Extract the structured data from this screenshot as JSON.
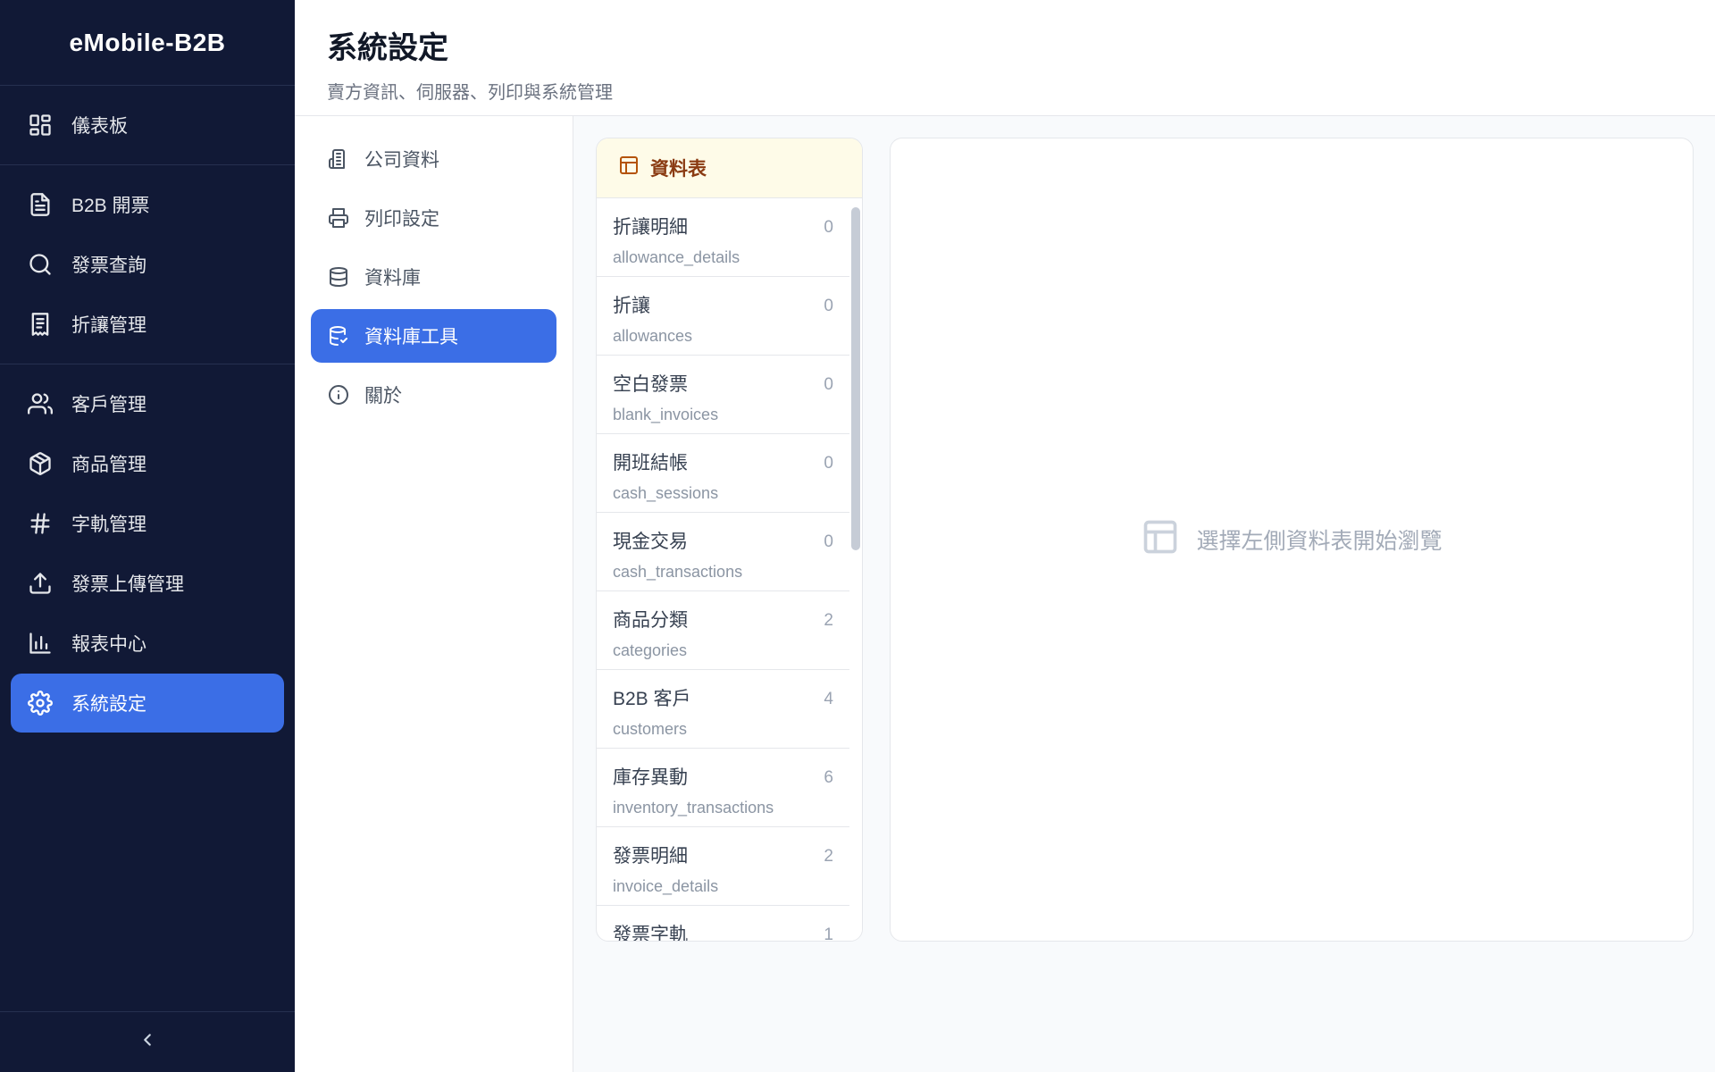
{
  "app": {
    "brand": "eMobile-B2B"
  },
  "sidebar": {
    "groups": [
      {
        "items": [
          {
            "label": "儀表板",
            "icon": "dashboard-icon"
          }
        ]
      },
      {
        "items": [
          {
            "label": "B2B 開票",
            "icon": "file-text-icon"
          },
          {
            "label": "發票查詢",
            "icon": "search-icon"
          },
          {
            "label": "折讓管理",
            "icon": "receipt-icon"
          }
        ]
      },
      {
        "items": [
          {
            "label": "客戶管理",
            "icon": "users-icon"
          },
          {
            "label": "商品管理",
            "icon": "package-icon"
          },
          {
            "label": "字軌管理",
            "icon": "hash-icon"
          },
          {
            "label": "發票上傳管理",
            "icon": "upload-icon"
          },
          {
            "label": "報表中心",
            "icon": "bar-chart-icon"
          },
          {
            "label": "系統設定",
            "icon": "gear-icon",
            "active": true
          }
        ]
      }
    ],
    "collapse_icon": "chevron-left-icon"
  },
  "header": {
    "title": "系統設定",
    "subtitle": "賣方資訊、伺服器、列印與系統管理"
  },
  "settings_nav": {
    "items": [
      {
        "label": "公司資料",
        "icon": "building-icon"
      },
      {
        "label": "列印設定",
        "icon": "printer-icon"
      },
      {
        "label": "資料庫",
        "icon": "database-icon"
      },
      {
        "label": "資料庫工具",
        "icon": "database-tool-icon",
        "active": true
      },
      {
        "label": "關於",
        "icon": "info-icon"
      }
    ]
  },
  "tables": {
    "heading": "資料表",
    "rows": [
      {
        "name": "折讓明細",
        "key": "allowance_details",
        "count": "0"
      },
      {
        "name": "折讓",
        "key": "allowances",
        "count": "0"
      },
      {
        "name": "空白發票",
        "key": "blank_invoices",
        "count": "0"
      },
      {
        "name": "開班結帳",
        "key": "cash_sessions",
        "count": "0"
      },
      {
        "name": "現金交易",
        "key": "cash_transactions",
        "count": "0"
      },
      {
        "name": "商品分類",
        "key": "categories",
        "count": "2"
      },
      {
        "name": "B2B 客戶",
        "key": "customers",
        "count": "4"
      },
      {
        "name": "庫存異動",
        "key": "inventory_transactions",
        "count": "6"
      },
      {
        "name": "發票明細",
        "key": "invoice_details",
        "count": "2"
      },
      {
        "name": "發票字軌",
        "key": "",
        "count": "1"
      }
    ]
  },
  "preview": {
    "empty_message": "選擇左側資料表開始瀏覽",
    "icon": "table-icon"
  },
  "colors": {
    "sidebar_bg": "#111936",
    "accent": "#3b6ee6",
    "tables_header_bg": "#fefbe8",
    "tables_header_text": "#8a3b12"
  }
}
